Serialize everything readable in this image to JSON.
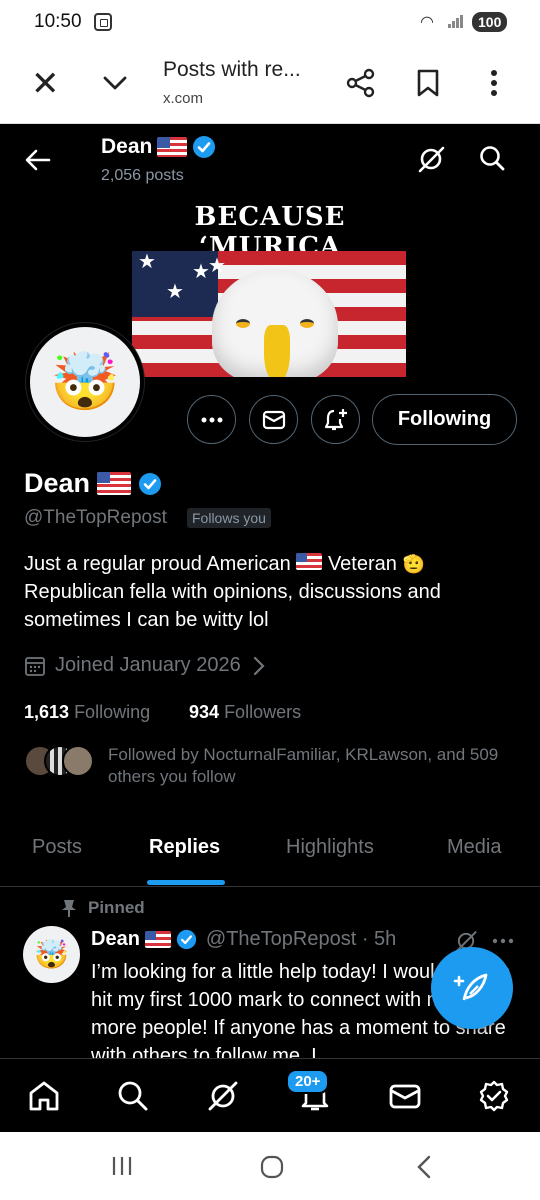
{
  "status_bar": {
    "time": "10:50",
    "battery": "100"
  },
  "browser": {
    "title": "Posts with re...",
    "url": "x.com"
  },
  "header": {
    "name": "Dean",
    "post_count": "2,056 posts"
  },
  "banner": {
    "title": "BECAUSE ‘MURICA"
  },
  "actions": {
    "following_label": "Following"
  },
  "profile": {
    "name": "Dean",
    "handle": "@TheTopRepost",
    "follows_you": "Follows you",
    "bio_line1": "Just a regular proud American",
    "bio_line1b": "Veteran",
    "bio_line2": "Republican fella with opinions, discussions and",
    "bio_line3": "sometimes I can be witty lol",
    "joined": "Joined January 2026",
    "following_count": "1,613",
    "following_label": "Following",
    "followers_count": "934",
    "followers_label": "Followers",
    "followed_by": "Followed by NocturnalFamiliar, KRLawson, and 509 others you follow"
  },
  "tabs": [
    "Posts",
    "Replies",
    "Highlights",
    "Media"
  ],
  "active_tab": "Replies",
  "post": {
    "pinned_label": "Pinned",
    "name": "Dean",
    "handle_time": "@TheTopRepost · 5h",
    "text": "I’m looking for a little help today! I would love to hit my first 1000 mark to connect with new and more people! If anyone has a moment to share with others to follow me, I"
  },
  "bottom_nav": {
    "notifications_badge": "20+"
  },
  "colors": {
    "accent": "#1d9bf0",
    "background": "#000000",
    "muted": "#71767b"
  },
  "icons": [
    "close-icon",
    "chevron-down-icon",
    "share-icon",
    "bookmark-icon",
    "more-vert-icon",
    "back-arrow-icon",
    "grok-icon",
    "search-icon",
    "verified-badge-icon",
    "mail-icon",
    "notify-plus-icon",
    "calendar-icon",
    "pin-icon",
    "compose-icon",
    "home-icon",
    "bell-icon",
    "communities-icon"
  ]
}
